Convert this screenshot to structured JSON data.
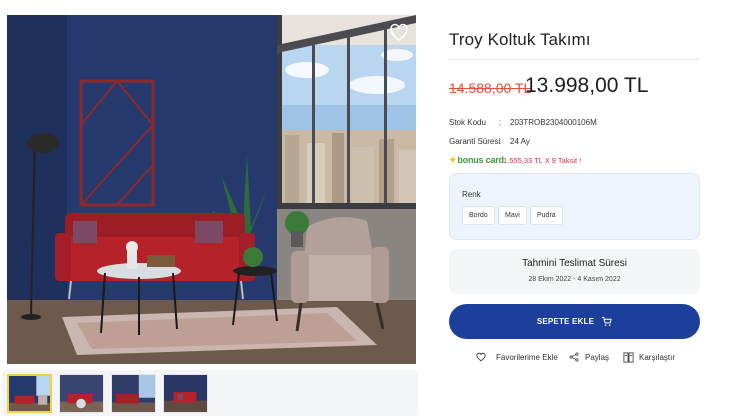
{
  "product": {
    "title": "Troy Koltuk Takımı",
    "old_price": "14.588,00 TL",
    "new_price": "13.998,00 TL"
  },
  "specs": [
    {
      "label": "Stok Kodu",
      "value": "203TROB2304000106M"
    },
    {
      "label": "Garanti Süresi",
      "value": "24 Ay"
    }
  ],
  "spec_separator": ":",
  "bonus": {
    "logo_text": "bonus card",
    "installment_text": "1.555,33 TL X 9 Taksit !"
  },
  "color_picker": {
    "label": "Renk",
    "options": [
      "Bordo",
      "Mavi",
      "Pudra"
    ]
  },
  "delivery": {
    "title": "Tahmini Teslimat Süresi",
    "dates": "28 Ekim 2022 - 4 Kasım 2022"
  },
  "cart_button": {
    "label": "SEPETE EKLE",
    "icon": "cart-icon"
  },
  "actions": [
    {
      "label": "Favorilerime Ekle",
      "icon": "heart-icon"
    },
    {
      "label": "Paylaş",
      "icon": "share-icon"
    },
    {
      "label": "Karşılaştır",
      "icon": "compare-icon"
    }
  ],
  "gallery": {
    "thumbnail_count": 4,
    "active_index": 0
  },
  "colors": {
    "accent_blue": "#1b3f9a",
    "sale_red": "#e0503a",
    "installment_red": "#e0304a",
    "bonus_green": "#3a9a3a",
    "active_thumb_border": "#f3d23a"
  }
}
